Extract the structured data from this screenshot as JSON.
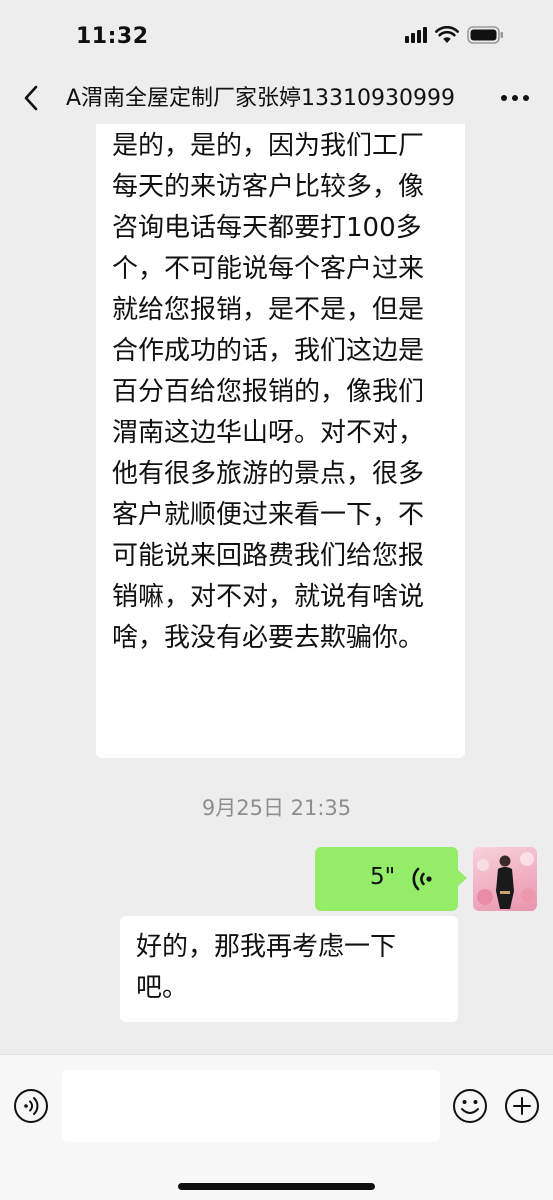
{
  "status_bar": {
    "time": "11:32",
    "icons": [
      "signal-icon",
      "wifi-icon",
      "battery-icon"
    ]
  },
  "nav": {
    "title": "A渭南全屋定制厂家张婷13310930999",
    "back_icon": "chevron-left-icon",
    "more_icon": "more-dots-icon"
  },
  "messages": [
    {
      "direction": "incoming",
      "type": "text",
      "text": "是的，是的，因为我们工厂每天的来访客户比较多，像咨询电话每天都要打100多个，不可能说每个客户过来就给您报销，是不是，但是合作成功的话，我们这边是百分百给您报销的，像我们渭南这边华山呀。对不对，他有很多旅游的景点，很多客户就顺便过来看一下，不可能说来回路费我们给您报销嘛，对不对，就说有啥说啥，我没有必要去欺骗你。"
    },
    {
      "type": "timestamp",
      "text": "9月25日 21:35"
    },
    {
      "direction": "outgoing",
      "type": "voice",
      "duration": "5\"",
      "icon": "voice-wave-icon"
    },
    {
      "direction": "incoming",
      "type": "text",
      "text": "好的，那我再考虑一下吧。"
    }
  ],
  "input_bar": {
    "value": "",
    "placeholder": "",
    "voice_icon": "voice-input-icon",
    "emoji_icon": "emoji-icon",
    "plus_icon": "plus-icon"
  },
  "colors": {
    "background": "#ededed",
    "incoming_bubble": "#ffffff",
    "outgoing_bubble": "#95ec69",
    "timestamp_text": "#8e8e8e"
  }
}
